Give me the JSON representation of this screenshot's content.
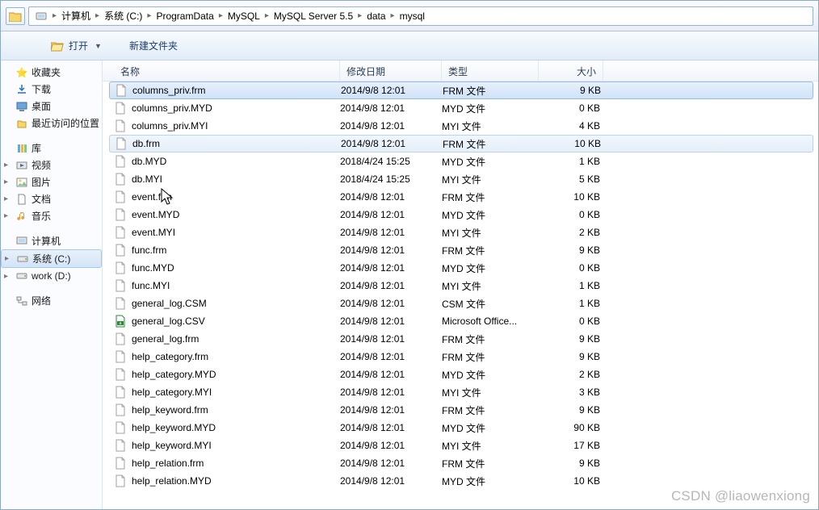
{
  "breadcrumb": {
    "items": [
      "计算机",
      "系统 (C:)",
      "ProgramData",
      "MySQL",
      "MySQL Server 5.5",
      "data",
      "mysql"
    ]
  },
  "toolbar": {
    "open": "打开",
    "newfolder": "新建文件夹"
  },
  "columns": {
    "name": "名称",
    "date": "修改日期",
    "type": "类型",
    "size": "大小"
  },
  "nav": {
    "fav_header": "收藏夹",
    "fav": [
      "下载",
      "桌面",
      "最近访问的位置"
    ],
    "lib_header": "库",
    "lib": [
      "视频",
      "图片",
      "文档",
      "音乐"
    ],
    "comp_header": "计算机",
    "drives": [
      "系统 (C:)",
      "work (D:)"
    ],
    "net_header": "网络"
  },
  "files": [
    {
      "n": "columns_priv.frm",
      "d": "2014/9/8 12:01",
      "t": "FRM 文件",
      "s": "9 KB",
      "sel": true
    },
    {
      "n": "columns_priv.MYD",
      "d": "2014/9/8 12:01",
      "t": "MYD 文件",
      "s": "0 KB"
    },
    {
      "n": "columns_priv.MYI",
      "d": "2014/9/8 12:01",
      "t": "MYI 文件",
      "s": "4 KB"
    },
    {
      "n": "db.frm",
      "d": "2014/9/8 12:01",
      "t": "FRM 文件",
      "s": "10 KB",
      "hov": true
    },
    {
      "n": "db.MYD",
      "d": "2018/4/24 15:25",
      "t": "MYD 文件",
      "s": "1 KB"
    },
    {
      "n": "db.MYI",
      "d": "2018/4/24 15:25",
      "t": "MYI 文件",
      "s": "5 KB"
    },
    {
      "n": "event.frm",
      "d": "2014/9/8 12:01",
      "t": "FRM 文件",
      "s": "10 KB"
    },
    {
      "n": "event.MYD",
      "d": "2014/9/8 12:01",
      "t": "MYD 文件",
      "s": "0 KB"
    },
    {
      "n": "event.MYI",
      "d": "2014/9/8 12:01",
      "t": "MYI 文件",
      "s": "2 KB"
    },
    {
      "n": "func.frm",
      "d": "2014/9/8 12:01",
      "t": "FRM 文件",
      "s": "9 KB"
    },
    {
      "n": "func.MYD",
      "d": "2014/9/8 12:01",
      "t": "MYD 文件",
      "s": "0 KB"
    },
    {
      "n": "func.MYI",
      "d": "2014/9/8 12:01",
      "t": "MYI 文件",
      "s": "1 KB"
    },
    {
      "n": "general_log.CSM",
      "d": "2014/9/8 12:01",
      "t": "CSM 文件",
      "s": "1 KB"
    },
    {
      "n": "general_log.CSV",
      "d": "2014/9/8 12:01",
      "t": "Microsoft Office...",
      "s": "0 KB",
      "csv": true
    },
    {
      "n": "general_log.frm",
      "d": "2014/9/8 12:01",
      "t": "FRM 文件",
      "s": "9 KB"
    },
    {
      "n": "help_category.frm",
      "d": "2014/9/8 12:01",
      "t": "FRM 文件",
      "s": "9 KB"
    },
    {
      "n": "help_category.MYD",
      "d": "2014/9/8 12:01",
      "t": "MYD 文件",
      "s": "2 KB"
    },
    {
      "n": "help_category.MYI",
      "d": "2014/9/8 12:01",
      "t": "MYI 文件",
      "s": "3 KB"
    },
    {
      "n": "help_keyword.frm",
      "d": "2014/9/8 12:01",
      "t": "FRM 文件",
      "s": "9 KB"
    },
    {
      "n": "help_keyword.MYD",
      "d": "2014/9/8 12:01",
      "t": "MYD 文件",
      "s": "90 KB"
    },
    {
      "n": "help_keyword.MYI",
      "d": "2014/9/8 12:01",
      "t": "MYI 文件",
      "s": "17 KB"
    },
    {
      "n": "help_relation.frm",
      "d": "2014/9/8 12:01",
      "t": "FRM 文件",
      "s": "9 KB"
    },
    {
      "n": "help_relation.MYD",
      "d": "2014/9/8 12:01",
      "t": "MYD 文件",
      "s": "10 KB"
    }
  ],
  "watermark": "CSDN @liaowenxiong"
}
